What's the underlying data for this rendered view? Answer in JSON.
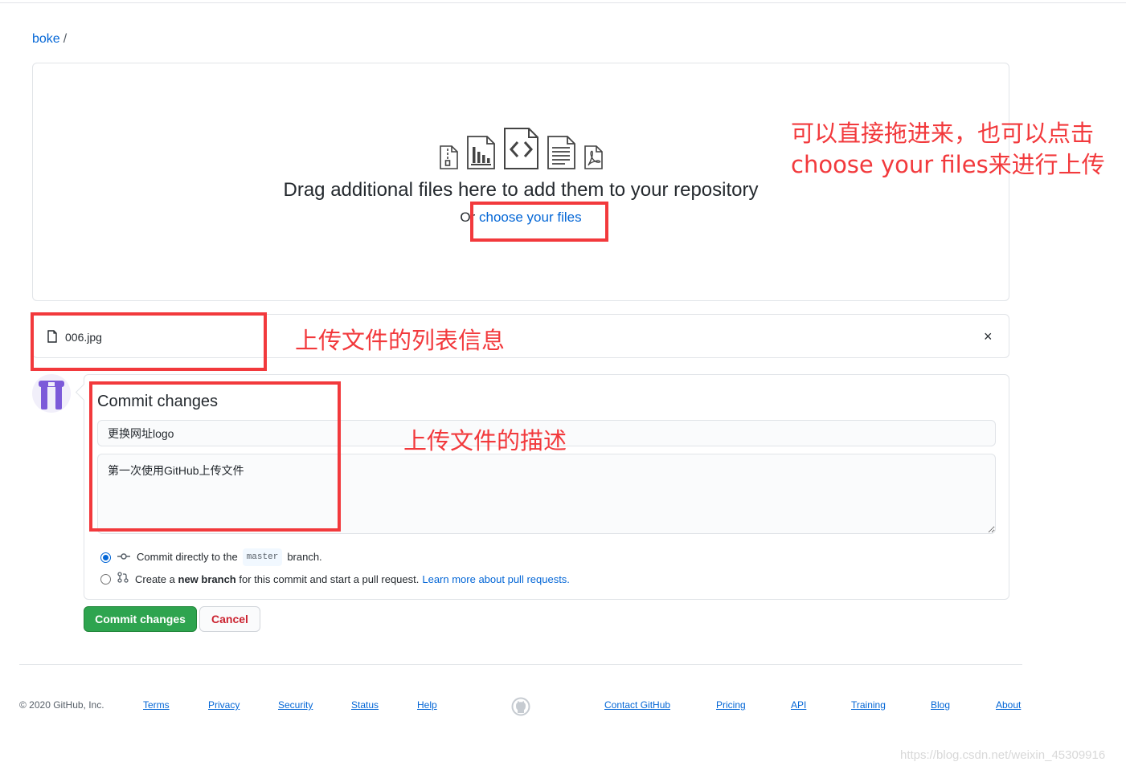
{
  "breadcrumb": {
    "repo": "boke",
    "separator": "/"
  },
  "dropzone": {
    "file_type_icons": [
      "file-zip-icon",
      "file-chart-icon",
      "file-code-icon",
      "file-text-icon",
      "file-pdf-icon"
    ],
    "title": "Drag additional files here to add them to your repository",
    "or_text": "Or",
    "choose_link": "choose your files"
  },
  "file_list": [
    {
      "name": "006.jpg",
      "remove_label": "×"
    }
  ],
  "commit": {
    "title": "Commit changes",
    "summary_value": "更换网址logo",
    "description_value": "第一次使用GitHub上传文件",
    "option_direct": {
      "prefix": "Commit directly to the",
      "branch": "master",
      "suffix": "branch.",
      "selected": true
    },
    "option_new_branch": {
      "prefix": "Create a",
      "bold": "new branch",
      "rest": "for this commit and start a pull request.",
      "link": "Learn more about pull requests.",
      "selected": false
    },
    "commit_button": "Commit changes",
    "cancel_button": "Cancel"
  },
  "footer": {
    "copyright": "© 2020 GitHub, Inc.",
    "left_links": [
      "Terms",
      "Privacy",
      "Security",
      "Status",
      "Help"
    ],
    "right_links": [
      "Contact GitHub",
      "Pricing",
      "API",
      "Training",
      "Blog",
      "About"
    ]
  },
  "annotations": {
    "drag_note_line1": "可以直接拖进来，也可以点击",
    "drag_note_line2": "choose your files来进行上传",
    "file_list_note": "上传文件的列表信息",
    "description_note": "上传文件的描述"
  },
  "watermark": "https://blog.csdn.net/weixin_45309916",
  "colors": {
    "link": "#0366d6",
    "commit_green": "#2ea44f",
    "cancel_red": "#cb2431",
    "annotation_red": "#f2393c"
  }
}
